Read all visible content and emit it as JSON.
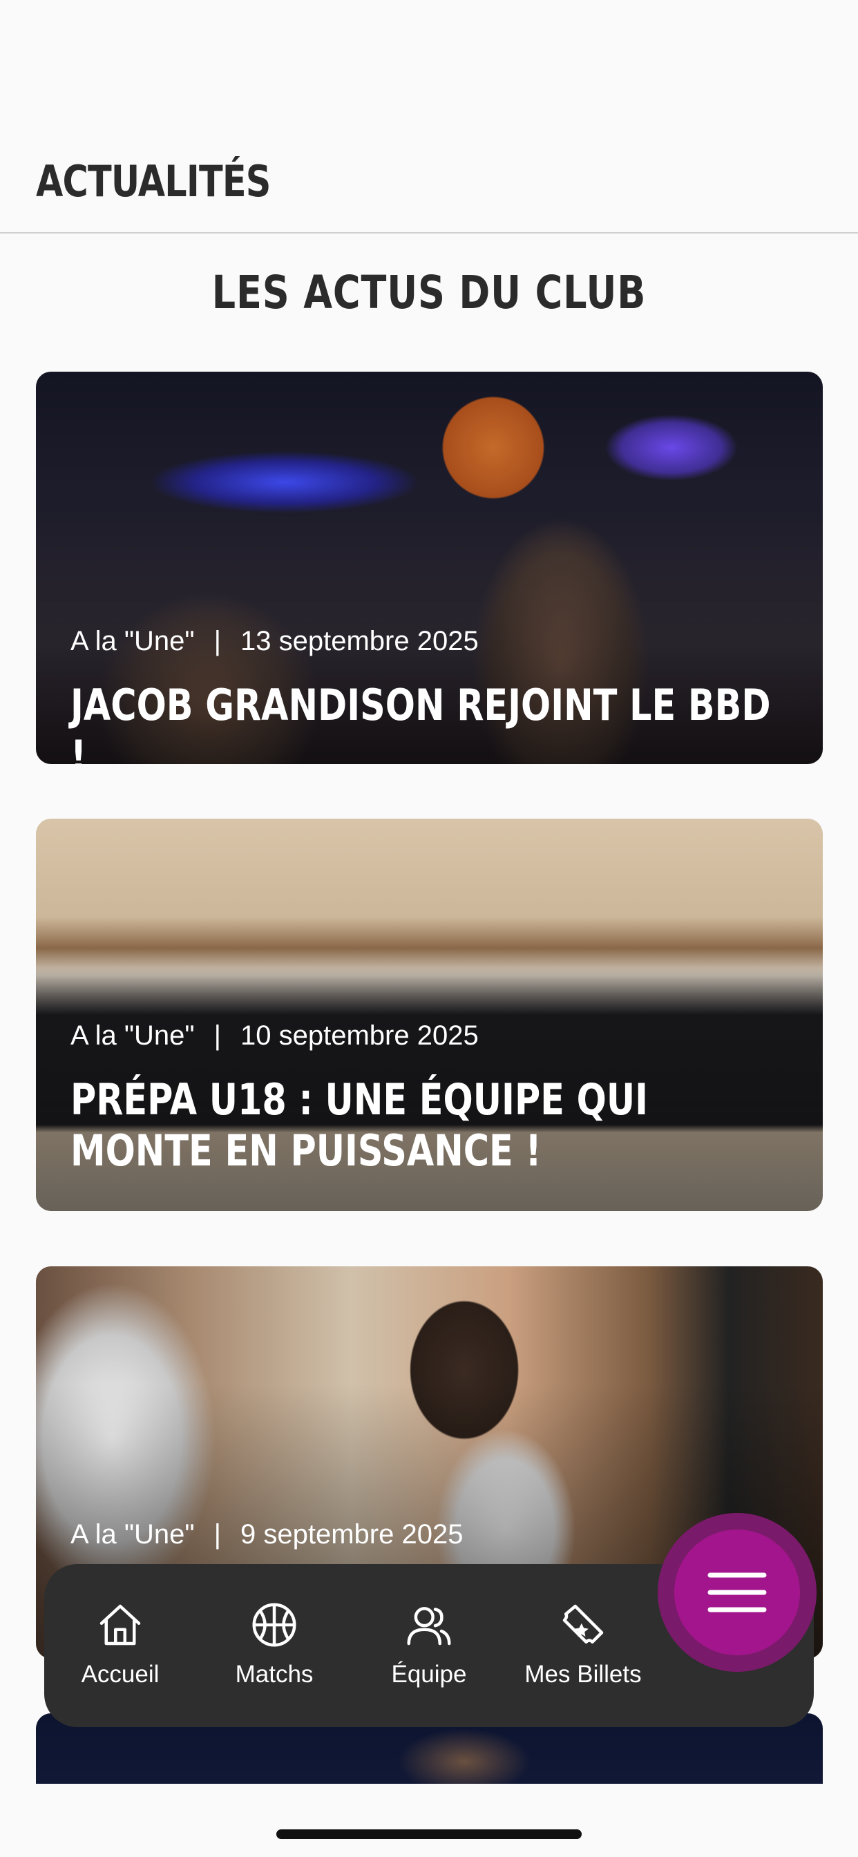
{
  "header": {
    "title": "ACTUALITÉS"
  },
  "section": {
    "title": "LES ACTUS DU CLUB"
  },
  "news": [
    {
      "category": "A la \"Une\"",
      "date": "13 septembre 2025",
      "title": "JACOB GRANDISON REJOINT LE BBD !"
    },
    {
      "category": "A la \"Une\"",
      "date": "10 septembre 2025",
      "title": "PRÉPA U18 : UNE ÉQUIPE QUI MONTE EN PUISSANCE !"
    },
    {
      "category": "A la \"Une\"",
      "date": "9 septembre 2025",
      "title": ""
    }
  ],
  "separator": "|",
  "tabbar": {
    "items": [
      {
        "label": "Accueil",
        "icon": "home-icon"
      },
      {
        "label": "Matchs",
        "icon": "basketball-icon"
      },
      {
        "label": "Équipe",
        "icon": "users-icon"
      },
      {
        "label": "Mes Billets",
        "icon": "ticket-icon"
      }
    ],
    "menu_icon": "hamburger-menu-icon"
  },
  "colors": {
    "accent": "#a3158c",
    "tabbar_bg": "#2e2e2e",
    "background": "#fafafa"
  }
}
